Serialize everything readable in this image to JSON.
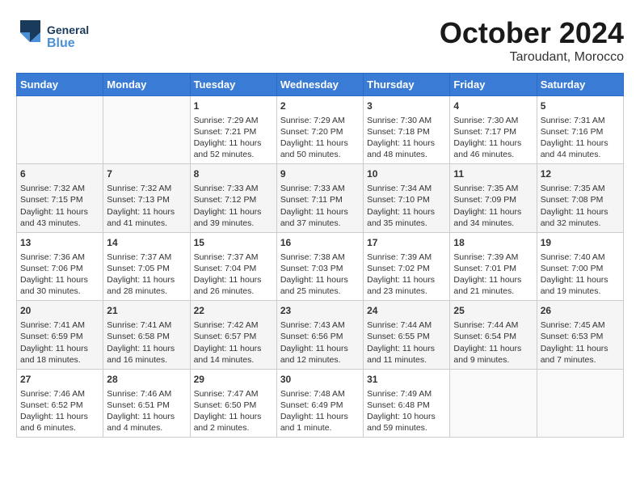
{
  "logo": {
    "general": "General",
    "blue": "Blue"
  },
  "title": "October 2024",
  "location": "Taroudant, Morocco",
  "days_header": [
    "Sunday",
    "Monday",
    "Tuesday",
    "Wednesday",
    "Thursday",
    "Friday",
    "Saturday"
  ],
  "weeks": [
    [
      {
        "day": "",
        "info": ""
      },
      {
        "day": "",
        "info": ""
      },
      {
        "day": "1",
        "info": "Sunrise: 7:29 AM\nSunset: 7:21 PM\nDaylight: 11 hours\nand 52 minutes."
      },
      {
        "day": "2",
        "info": "Sunrise: 7:29 AM\nSunset: 7:20 PM\nDaylight: 11 hours\nand 50 minutes."
      },
      {
        "day": "3",
        "info": "Sunrise: 7:30 AM\nSunset: 7:18 PM\nDaylight: 11 hours\nand 48 minutes."
      },
      {
        "day": "4",
        "info": "Sunrise: 7:30 AM\nSunset: 7:17 PM\nDaylight: 11 hours\nand 46 minutes."
      },
      {
        "day": "5",
        "info": "Sunrise: 7:31 AM\nSunset: 7:16 PM\nDaylight: 11 hours\nand 44 minutes."
      }
    ],
    [
      {
        "day": "6",
        "info": "Sunrise: 7:32 AM\nSunset: 7:15 PM\nDaylight: 11 hours\nand 43 minutes."
      },
      {
        "day": "7",
        "info": "Sunrise: 7:32 AM\nSunset: 7:13 PM\nDaylight: 11 hours\nand 41 minutes."
      },
      {
        "day": "8",
        "info": "Sunrise: 7:33 AM\nSunset: 7:12 PM\nDaylight: 11 hours\nand 39 minutes."
      },
      {
        "day": "9",
        "info": "Sunrise: 7:33 AM\nSunset: 7:11 PM\nDaylight: 11 hours\nand 37 minutes."
      },
      {
        "day": "10",
        "info": "Sunrise: 7:34 AM\nSunset: 7:10 PM\nDaylight: 11 hours\nand 35 minutes."
      },
      {
        "day": "11",
        "info": "Sunrise: 7:35 AM\nSunset: 7:09 PM\nDaylight: 11 hours\nand 34 minutes."
      },
      {
        "day": "12",
        "info": "Sunrise: 7:35 AM\nSunset: 7:08 PM\nDaylight: 11 hours\nand 32 minutes."
      }
    ],
    [
      {
        "day": "13",
        "info": "Sunrise: 7:36 AM\nSunset: 7:06 PM\nDaylight: 11 hours\nand 30 minutes."
      },
      {
        "day": "14",
        "info": "Sunrise: 7:37 AM\nSunset: 7:05 PM\nDaylight: 11 hours\nand 28 minutes."
      },
      {
        "day": "15",
        "info": "Sunrise: 7:37 AM\nSunset: 7:04 PM\nDaylight: 11 hours\nand 26 minutes."
      },
      {
        "day": "16",
        "info": "Sunrise: 7:38 AM\nSunset: 7:03 PM\nDaylight: 11 hours\nand 25 minutes."
      },
      {
        "day": "17",
        "info": "Sunrise: 7:39 AM\nSunset: 7:02 PM\nDaylight: 11 hours\nand 23 minutes."
      },
      {
        "day": "18",
        "info": "Sunrise: 7:39 AM\nSunset: 7:01 PM\nDaylight: 11 hours\nand 21 minutes."
      },
      {
        "day": "19",
        "info": "Sunrise: 7:40 AM\nSunset: 7:00 PM\nDaylight: 11 hours\nand 19 minutes."
      }
    ],
    [
      {
        "day": "20",
        "info": "Sunrise: 7:41 AM\nSunset: 6:59 PM\nDaylight: 11 hours\nand 18 minutes."
      },
      {
        "day": "21",
        "info": "Sunrise: 7:41 AM\nSunset: 6:58 PM\nDaylight: 11 hours\nand 16 minutes."
      },
      {
        "day": "22",
        "info": "Sunrise: 7:42 AM\nSunset: 6:57 PM\nDaylight: 11 hours\nand 14 minutes."
      },
      {
        "day": "23",
        "info": "Sunrise: 7:43 AM\nSunset: 6:56 PM\nDaylight: 11 hours\nand 12 minutes."
      },
      {
        "day": "24",
        "info": "Sunrise: 7:44 AM\nSunset: 6:55 PM\nDaylight: 11 hours\nand 11 minutes."
      },
      {
        "day": "25",
        "info": "Sunrise: 7:44 AM\nSunset: 6:54 PM\nDaylight: 11 hours\nand 9 minutes."
      },
      {
        "day": "26",
        "info": "Sunrise: 7:45 AM\nSunset: 6:53 PM\nDaylight: 11 hours\nand 7 minutes."
      }
    ],
    [
      {
        "day": "27",
        "info": "Sunrise: 7:46 AM\nSunset: 6:52 PM\nDaylight: 11 hours\nand 6 minutes."
      },
      {
        "day": "28",
        "info": "Sunrise: 7:46 AM\nSunset: 6:51 PM\nDaylight: 11 hours\nand 4 minutes."
      },
      {
        "day": "29",
        "info": "Sunrise: 7:47 AM\nSunset: 6:50 PM\nDaylight: 11 hours\nand 2 minutes."
      },
      {
        "day": "30",
        "info": "Sunrise: 7:48 AM\nSunset: 6:49 PM\nDaylight: 11 hours\nand 1 minute."
      },
      {
        "day": "31",
        "info": "Sunrise: 7:49 AM\nSunset: 6:48 PM\nDaylight: 10 hours\nand 59 minutes."
      },
      {
        "day": "",
        "info": ""
      },
      {
        "day": "",
        "info": ""
      }
    ]
  ]
}
